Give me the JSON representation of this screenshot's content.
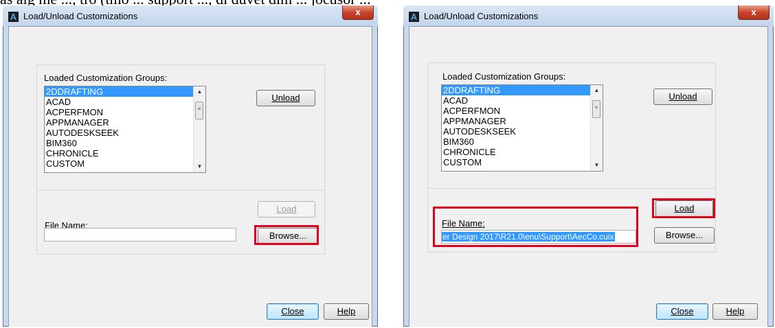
{
  "caption": "as aig me ..., tro (tmo ... support ..., di duvet dim ... jocusor ...",
  "dialog_left": {
    "title": "Load/Unload Customizations",
    "close_glyph": "x",
    "groups_label": "Loaded Customization Groups:",
    "groups": [
      "2DDRAFTING",
      "ACAD",
      "ACPERFMON",
      "APPMANAGER",
      "AUTODESKSEEK",
      "BIM360",
      "CHRONICLE",
      "CUSTOM"
    ],
    "selected_group": "2DDRAFTING",
    "unload_label": "Unload",
    "load_label": "Load",
    "file_name_label": "File Name:",
    "file_name_value": "",
    "browse_label": "Browse...",
    "close_label": "Close",
    "help_label": "Help"
  },
  "dialog_right": {
    "title": "Load/Unload Customizations",
    "close_glyph": "x",
    "groups_label": "Loaded Customization Groups:",
    "groups": [
      "2DDRAFTING",
      "ACAD",
      "ACPERFMON",
      "APPMANAGER",
      "AUTODESKSEEK",
      "BIM360",
      "CHRONICLE",
      "CUSTOM"
    ],
    "selected_group": "2DDRAFTING",
    "unload_label": "Unload",
    "load_label": "Load",
    "file_name_label": "File Name:",
    "file_name_value": "er Design 2017\\R21.0\\enu\\Support\\AecCo.cuix",
    "browse_label": "Browse...",
    "close_label": "Close",
    "help_label": "Help"
  },
  "colors": {
    "highlight_red": "#e3001b",
    "selection_blue": "#3399ff"
  }
}
